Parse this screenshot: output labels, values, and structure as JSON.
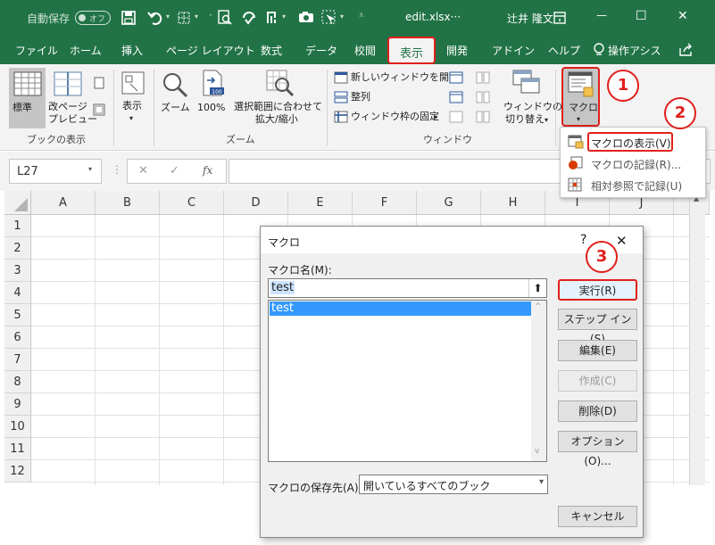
{
  "titlebar": {
    "autosave_label": "自動保存",
    "autosave_state": "オフ",
    "filename": "edit.xlsx···",
    "user": "辻井 隆文",
    "minimize": "—",
    "maximize": "☐",
    "close": "✕"
  },
  "tabs": [
    {
      "label": "ファイル"
    },
    {
      "label": "ホーム"
    },
    {
      "label": "挿入"
    },
    {
      "label": "ページ レイアウト"
    },
    {
      "label": "数式"
    },
    {
      "label": "データ"
    },
    {
      "label": "校閲"
    },
    {
      "label": "表示"
    },
    {
      "label": "開発"
    },
    {
      "label": "アドイン"
    },
    {
      "label": "ヘルプ"
    },
    {
      "label": "操作アシス"
    }
  ],
  "ribbon": {
    "workbook_views": {
      "group_label": "ブックの表示",
      "normal": "標準",
      "page_break_1": "改ページ",
      "page_break_2": "プレビュー"
    },
    "show": {
      "label": "表示"
    },
    "zoom": {
      "group_label": "ズーム",
      "zoom": "ズーム",
      "hundred": "100%",
      "fit_1": "選択範囲に合わせて",
      "fit_2": "拡大/縮小"
    },
    "window": {
      "group_label": "ウィンドウ",
      "new_window": "新しいウィンドウを開く",
      "arrange": "整列",
      "freeze": "ウィンドウ枠の固定",
      "switch_1": "ウィンドウの",
      "switch_2": "切り替え"
    },
    "macros": {
      "label": "マクロ"
    }
  },
  "formula_bar": {
    "name_box": "L27",
    "cancel": "✕",
    "enter": "✓",
    "fx": "fx",
    "value": ""
  },
  "grid": {
    "columns": [
      "A",
      "B",
      "C",
      "D",
      "E",
      "F",
      "G",
      "H",
      "I",
      "J"
    ],
    "rows": [
      "1",
      "2",
      "3",
      "4",
      "5",
      "6",
      "7",
      "8",
      "9",
      "10",
      "11",
      "12"
    ]
  },
  "macro_menu": {
    "items": [
      {
        "label": "マクロの表示(V)"
      },
      {
        "label": "マクロの記録(R)..."
      },
      {
        "label": "相対参照で記録(U)"
      }
    ]
  },
  "dialog": {
    "title": "マクロ",
    "help": "?",
    "close": "✕",
    "name_label": "マクロ名(M):",
    "name_value": "test",
    "list_items": [
      "test"
    ],
    "buttons": {
      "run": "実行(R)",
      "step_into": "ステップ イン(S)",
      "edit": "編集(E)",
      "create": "作成(C)",
      "delete": "削除(D)",
      "options": "オプション(O)...",
      "cancel": "キャンセル"
    },
    "macros_in_label": "マクロの保存先(A):",
    "macros_in_value": "開いているすべてのブック"
  },
  "callouts": [
    "1",
    "2",
    "3"
  ],
  "colors": {
    "excel_green": "#217346",
    "highlight_red": "#e0201b",
    "selection_blue": "#3399ff"
  }
}
